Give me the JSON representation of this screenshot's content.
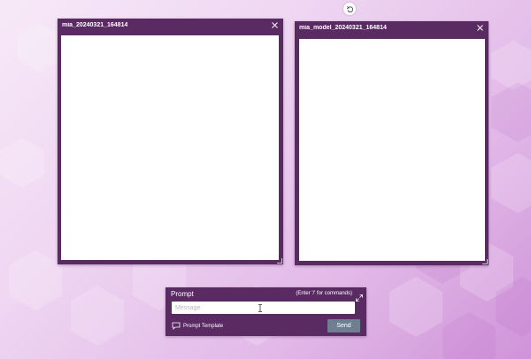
{
  "windows": [
    {
      "title": "mia_20240321_164814",
      "close_icon": "close-icon"
    },
    {
      "title": "mia_model_20240321_164814",
      "close_icon": "close-icon"
    }
  ],
  "toolbar": {
    "undo_icon": "undo-icon"
  },
  "prompt": {
    "title": "Prompt",
    "hint": "(Enter '/' for commands)",
    "message_placeholder": "Message",
    "message_value": "",
    "template_label": "Prompt Template",
    "send_label": "Send",
    "expand_icon": "expand-icon",
    "template_icon": "chat-bubble-icon"
  },
  "colors": {
    "panel": "#5a2a63",
    "send_button": "#6f7f91",
    "background": "#efd6f2"
  }
}
